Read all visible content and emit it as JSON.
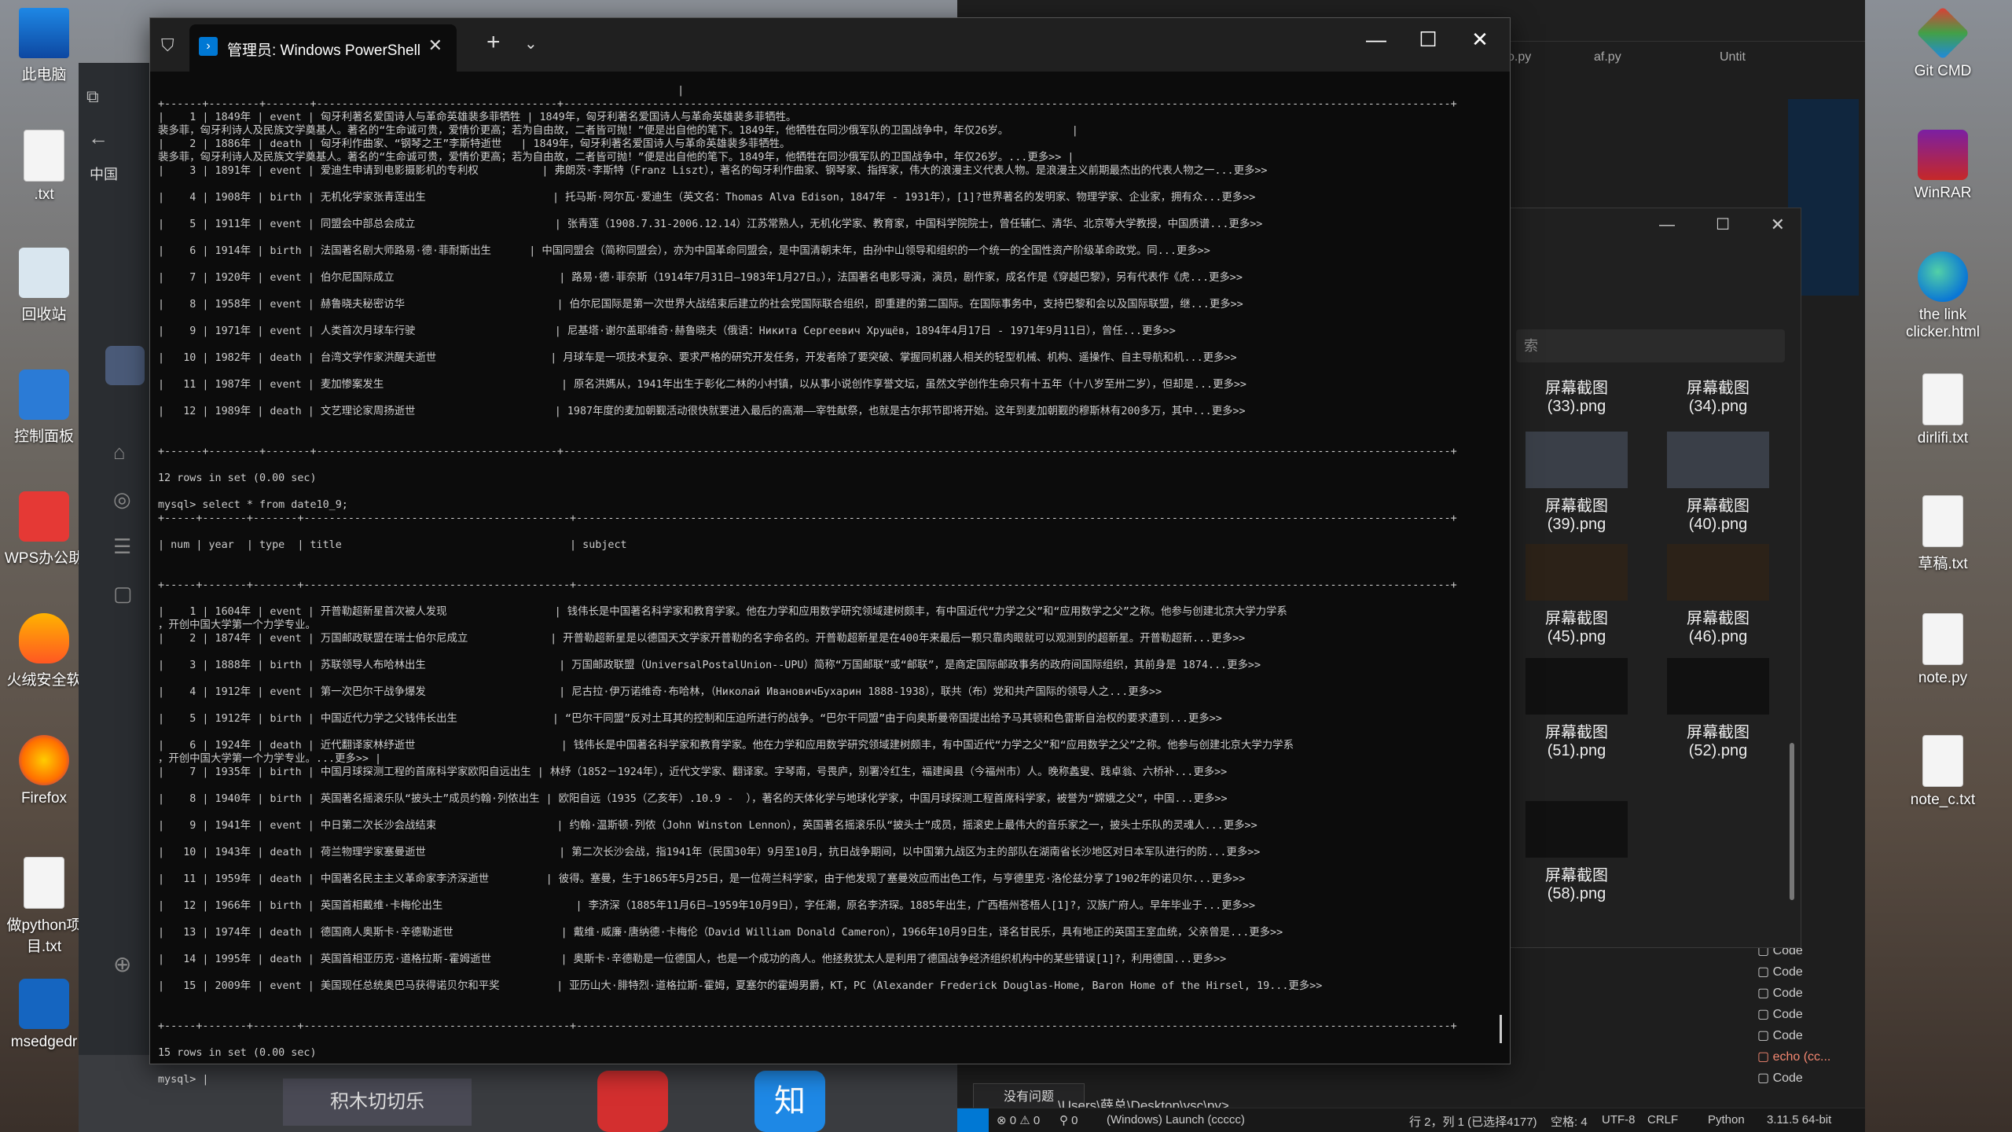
{
  "desktop": {
    "left_icons": [
      {
        "label": "此电脑",
        "icon": "monitor"
      },
      {
        "label": ".txt",
        "icon": "file"
      },
      {
        "label": "回收站",
        "icon": "recycle"
      },
      {
        "label": "控制面板",
        "icon": "panel"
      },
      {
        "label": "WPS办公助",
        "icon": "wps"
      },
      {
        "label": "火绒安全软",
        "icon": "fire"
      },
      {
        "label": "Firefox",
        "icon": "ff"
      },
      {
        "label": "做python项目.txt",
        "icon": "file"
      },
      {
        "label": "msedgedr",
        "icon": "msedge"
      }
    ],
    "right_icons": [
      {
        "label": "Git CMD",
        "icon": "git"
      },
      {
        "label": "WinRAR",
        "icon": "rar"
      },
      {
        "label": "the link clicker.html",
        "icon": "edge"
      },
      {
        "label": "dirlifi.txt",
        "icon": "file"
      },
      {
        "label": "草稿.txt",
        "icon": "file"
      },
      {
        "label": "note.py",
        "icon": "file"
      },
      {
        "label": "note_c.txt",
        "icon": "file"
      }
    ],
    "left_window_text": "中国",
    "taskbar_app_label": "积木切切乐",
    "zhi_label": "知"
  },
  "vscode": {
    "tabs": [
      "o.py",
      "af.py",
      "Untit"
    ],
    "terminal_list": [
      "Code",
      "Code",
      "Code",
      "Code",
      "Code",
      "echo (cc...",
      "Code"
    ],
    "problems_label": "没有问题",
    "path": "\\Users\\薛总\\Desktop\\vsc\\py>",
    "status": {
      "errors": "⊗ 0 ⚠ 0",
      "ports": "⚲ 0",
      "launch": "(Windows) Launch (ccccc)",
      "position": "行 2，列 1 (已选择4177)",
      "spaces": "空格: 4",
      "encoding": "UTF-8",
      "eol": "CRLF",
      "language": "Python",
      "version": "3.11.5 64-bit"
    }
  },
  "explorer": {
    "search_placeholder": "索",
    "thumbs": [
      {
        "label": "屏幕截图\n(33).png"
      },
      {
        "label": "屏幕截图\n(34).png"
      },
      {
        "label": "屏幕截图\n(39).png"
      },
      {
        "label": "屏幕截图\n(40).png"
      },
      {
        "label": "屏幕截图\n(45).png"
      },
      {
        "label": "屏幕截图\n(46).png"
      },
      {
        "label": "屏幕截图\n(51).png"
      },
      {
        "label": "屏幕截图\n(52).png"
      },
      {
        "label": "屏幕截图\n(58).png"
      }
    ]
  },
  "powershell": {
    "tab_title": "管理员: Windows PowerShell",
    "window_controls": {
      "minimize": "—",
      "maximize": "☐",
      "close": "✕"
    },
    "console_lines": [
      "                                                                                  |",
      "+------+--------+-------+--------------------------------------+--------------------------------------------------------------------------------------------------------------------------------------------+",
      "|    1 | 1849年 | event | 匈牙利著名爱国诗人与革命英雄裴多菲牺牲 | 1849年，匈牙利著名爱国诗人与革命英雄裴多菲牺牲。",
      "裴多菲，匈牙利诗人及民族文学奠基人。著名的“生命诚可贵，爱情价更高；若为自由故，二者皆可抛！”便是出自他的笔下。1849年，他牺牲在同沙俄军队的卫国战争中，年仅26岁。          |",
      "|    2 | 1886年 | death | 匈牙利作曲家、“钢琴之王”李斯特逝世   | 1849年，匈牙利著名爱国诗人与革命英雄裴多菲牺牲。",
      "裴多菲，匈牙利诗人及民族文学奠基人。著名的“生命诚可贵，爱情价更高；若为自由故，二者皆可抛！”便是出自他的笔下。1849年，他牺牲在同沙俄军队的卫国战争中，年仅26岁。...更多>> |",
      "|    3 | 1891年 | event | 爱迪生申请到电影摄影机的专利权          | 弗朗茨·李斯特（Franz Liszt），著名的匈牙利作曲家、钢琴家、指挥家，伟大的浪漫主义代表人物。是浪漫主义前期最杰出的代表人物之一...更多>>",
      "",
      "|    4 | 1908年 | birth | 无机化学家张青莲出生                    | 托马斯·阿尔瓦·爱迪生（英文名：Thomas Alva Edison，1847年 - 1931年），[1]?世界著名的发明家、物理学家、企业家，拥有众...更多>>",
      "",
      "|    5 | 1911年 | event | 同盟会中部总会成立                      | 张青莲（1908.7.31-2006.12.14）江苏常熟人，无机化学家、教育家，中国科学院院士，曾任辅仁、清华、北京等大学教授，中国质谱...更多>>",
      "",
      "|    6 | 1914年 | birth | 法国著名剧大师路易·德·菲耐斯出生      | 中国同盟会（简称同盟会），亦为中国革命同盟会，是中国清朝末年，由孙中山领导和组织的一个统一的全国性资产阶级革命政党。同...更多>>",
      "",
      "|    7 | 1920年 | event | 伯尔尼国际成立                          | 路易·德·菲奈斯（1914年7月31日—1983年1月27日。），法国著名电影导演，演员，剧作家，成名作是《穿越巴黎》，另有代表作《虎...更多>>",
      "",
      "|    8 | 1958年 | event | 赫鲁晓夫秘密访华                        | 伯尔尼国际是第一次世界大战结束后建立的社会党国际联合组织，即重建的第二国际。在国际事务中，支持巴黎和会以及国际联盟，继...更多>>",
      "",
      "|    9 | 1971年 | event | 人类首次月球车行驶                      | 尼基塔·谢尔盖耶维奇·赫鲁晓夫（俄语：Никита Сергеевич Хрущёв，1894年4月17日 - 1971年9月11日），曾任...更多>>",
      "",
      "|   10 | 1982年 | death | 台湾文学作家洪醒夫逝世                  | 月球车是一项技术复杂、要求严格的研究开发任务，开发者除了要突破、掌握同机器人相关的轻型机械、机构、遥操作、自主导航和机...更多>>",
      "",
      "|   11 | 1987年 | event | 麦加惨案发生                            | 原名洪媽从，1941年出生于彰化二林的小村镇，以从事小说创作享誉文坛，虽然文学创作生命只有十五年（十八岁至卅二岁），但却是...更多>>",
      "",
      "|   12 | 1989年 | death | 文艺理论家周扬逝世                      | 1987年度的麦加朝觐活动很快就要进入最后的高潮——宰牲献祭，也就是古尔邦节即将开始。这年到麦加朝觐的穆斯林有200多万，其中...更多>>",
      "",
      "",
      "+------+--------+-------+--------------------------------------+--------------------------------------------------------------------------------------------------------------------------------------------+",
      "",
      "12 rows in set (0.00 sec)",
      "",
      "mysql> select * from date10_9;",
      "+-----+-------+-------+------------------------------------------+------------------------------------------------------------------------------------------------------------------------------------------+",
      "",
      "| num | year  | type  | title                                    | subject",
      "",
      "",
      "+-----+-------+-------+------------------------------------------+------------------------------------------------------------------------------------------------------------------------------------------+",
      "",
      "|    1 | 1604年 | event | 开普勒超新星首次被人发现                 | 钱伟长是中国著名科学家和教育学家。他在力学和应用数学研究领域建树颇丰，有中国近代“力学之父”和“应用数学之父”之称。他参与创建北京大学力学系",
      "，开创中国大学第一个力学专业。",
      "|    2 | 1874年 | event | 万国邮政联盟在瑞士伯尔尼成立             | 开普勒超新星是以德国天文学家开普勒的名字命名的。开普勒超新星是在400年来最后一颗只靠肉眼就可以观测到的超新星。开普勒超新...更多>>",
      "",
      "|    3 | 1888年 | birth | 苏联领导人布哈林出生                     | 万国邮政联盟（UniversalPostalUnion--UPU）简称“万国邮联”或“邮联”，是商定国际邮政事务的政府间国际组织，其前身是 1874...更多>>",
      "",
      "|    4 | 1912年 | event | 第一次巴尔干战争爆发                     | 尼古拉·伊万诺维奇·布哈林，（Николай ИвановичБухарин 1888-1938），联共（布）党和共产国际的领导人之...更多>>",
      "",
      "|    5 | 1912年 | birth | 中国近代力学之父钱伟长出生               | “巴尔干同盟”反对土耳其的控制和压迫所进行的战争。“巴尔干同盟”由于向奥斯曼帝国提出给予马其顿和色雷斯自治权的要求遭到...更多>>",
      "",
      "|    6 | 1924年 | death | 近代翻译家林纾逝世                       | 钱伟长是中国著名科学家和教育学家。他在力学和应用数学研究领域建树颇丰，有中国近代“力学之父”和“应用数学之父”之称。他参与创建北京大学力学系",
      "，开创中国大学第一个力学专业。...更多>> |",
      "|    7 | 1935年 | birth | 中国月球探测工程的首席科学家欧阳自远出生 | 林纾（1852－1924年），近代文学家、翻译家。字琴南，号畏庐，别署冷红生，福建闽县（今福州市）人。晚称蠡叟、践卓翁、六桥补...更多>>",
      "",
      "|    8 | 1940年 | birth | 英国著名摇滚乐队“披头士”成员约翰·列侬出生 | 欧阳自远（1935（乙亥年）.10.9 -  ），著名的天体化学与地球化学家，中国月球探测工程首席科学家，被誉为“嫦娥之父”，中国...更多>>",
      "",
      "|    9 | 1941年 | event | 中日第二次长沙会战结束                   | 约翰·温斯顿·列侬（John Winston Lennon），英国著名摇滚乐队“披头士”成员，摇滚史上最伟大的音乐家之一，披头士乐队的灵魂人...更多>>",
      "",
      "|   10 | 1943年 | death | 荷兰物理学家塞曼逝世                     | 第二次长沙会战，指1941年（民国30年）9月至10月，抗日战争期间，以中国第九战区为主的部队在湖南省长沙地区对日本军队进行的防...更多>>",
      "",
      "|   11 | 1959年 | death | 中国著名民主主义革命家李济深逝世         | 彼得。塞曼，生于1865年5月25日，是一位荷兰科学家，由于他发现了塞曼效应而出色工作，与亨德里克·洛伦兹分享了1902年的诺贝尔...更多>>",
      "",
      "|   12 | 1966年 | birth | 英国首相戴维·卡梅伦出生                     | 李济深（1885年11月6日—1959年10月9日），字任潮，原名李济琛。1885年出生，广西梧州苍梧人[1]?，汉族广府人。早年毕业于...更多>>",
      "",
      "|   13 | 1974年 | death | 德国商人奥斯卡·辛德勒逝世                 | 戴维·威廉·唐纳德·卡梅伦（David William Donald Cameron），1966年10月9日生，译名甘民乐，具有地正的英国王室血统，父亲曾是...更多>>",
      "",
      "|   14 | 1995年 | death | 英国首相亚历克·道格拉斯-霍姆逝世           | 奥斯卡·辛德勒是一位德国人，也是一个成功的商人。他拯救犹太人是利用了德国战争经济组织机构中的某些错误[1]?，利用德国...更多>>",
      "",
      "|   15 | 2009年 | event | 美国现任总统奥巴马获得诺贝尔和平奖         | 亚历山大·腓特烈·道格拉斯-霍姆，夏塞尔的霍姆男爵，KT，PC（Alexander Frederick Douglas-Home, Baron Home of the Hirsel, 19...更多>>",
      "",
      "",
      "+-----+-------+-------+------------------------------------------+------------------------------------------------------------------------------------------------------------------------------------------+",
      "",
      "15 rows in set (0.00 sec)",
      "",
      "mysql> |"
    ]
  }
}
